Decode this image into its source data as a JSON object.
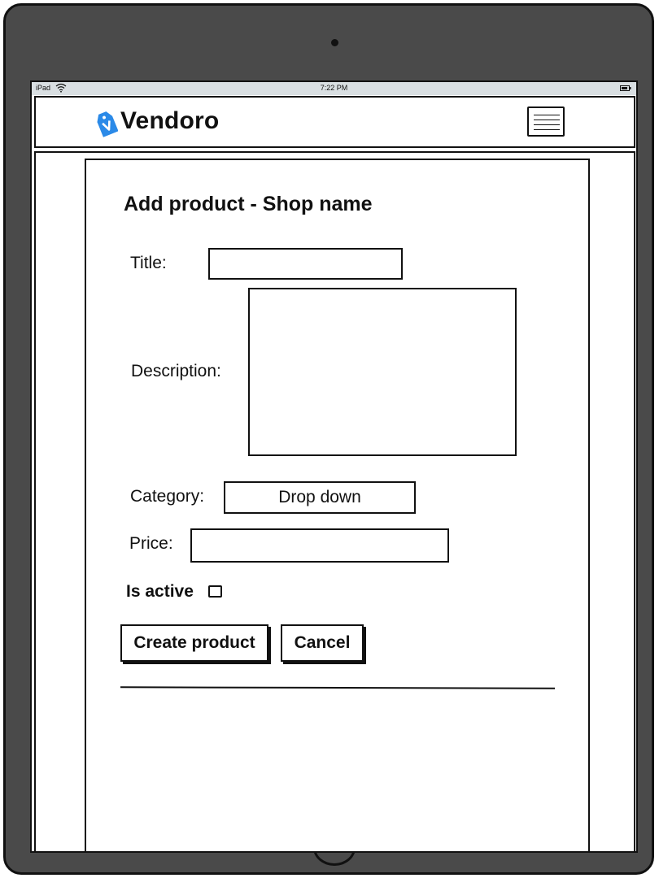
{
  "statusbar": {
    "device": "iPad",
    "time": "7:22 PM"
  },
  "header": {
    "brand": "Vendoro",
    "logo_icon": "price-tag-icon",
    "menu_icon": "hamburger-menu-icon"
  },
  "form": {
    "title": "Add product - Shop name",
    "title_label": "Title:",
    "title_value": "",
    "description_label": "Description:",
    "description_value": "",
    "category_label": "Category:",
    "category_value": "Drop down",
    "price_label": "Price:",
    "price_value": "",
    "is_active_label": "Is active",
    "is_active_checked": false,
    "create_label": "Create product",
    "cancel_label": "Cancel"
  },
  "colors": {
    "device_frame": "#4a4a4a",
    "logo_blue": "#2b8ae8",
    "statusbar_bg": "#d9dfe2",
    "ink": "#111111"
  }
}
